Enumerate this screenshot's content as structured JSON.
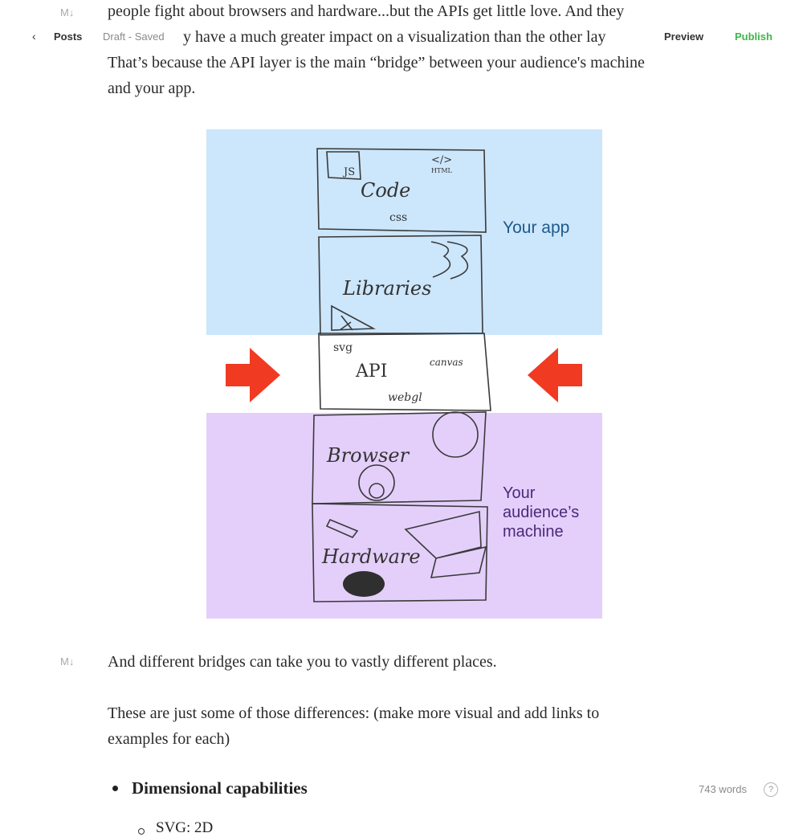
{
  "topbar": {
    "back_icon": "‹",
    "posts_label": "Posts",
    "status": "Draft - Saved",
    "preview_label": "Preview",
    "publish_label": "Publish"
  },
  "markdown_icon": "M↓",
  "paragraphs": {
    "p1_line1": "people fight about browsers and hardware...but the APIs get little love. And they",
    "p1_line2": "y have a much greater impact on a visualization than the other lay",
    "p1_line3": "That’s because the API layer is the main “bridge” between your audience's machine",
    "p1_line4": "and your app.",
    "p2": "And different bridges can take you to vastly different places.",
    "p3_line1": "These are just some of those differences: (make more visual and add links to",
    "p3_line2": "examples for each)"
  },
  "figure": {
    "app_label": "Your app",
    "machine_label_1": "Your",
    "machine_label_2": "audience’s",
    "machine_label_3": "machine",
    "sketch": {
      "js": "JS",
      "html_tag": "</>",
      "html": "HTML",
      "code": "Code",
      "css": "css",
      "libraries": "Libraries",
      "svg": "svg",
      "api": "API",
      "canvas": "canvas",
      "webgl": "webgl",
      "browser": "Browser",
      "hardware": "Hardware"
    },
    "colors": {
      "app_bg": "#cce6fb",
      "machine_bg": "#e4cffb",
      "arrow": "#f03a22",
      "app_label": "#1f5a8c",
      "machine_label": "#4a2a78"
    }
  },
  "list": {
    "item1": "Dimensional capabilities",
    "sub1": "SVG: 2D"
  },
  "footer": {
    "word_count": "743 words",
    "help_icon": "?"
  }
}
